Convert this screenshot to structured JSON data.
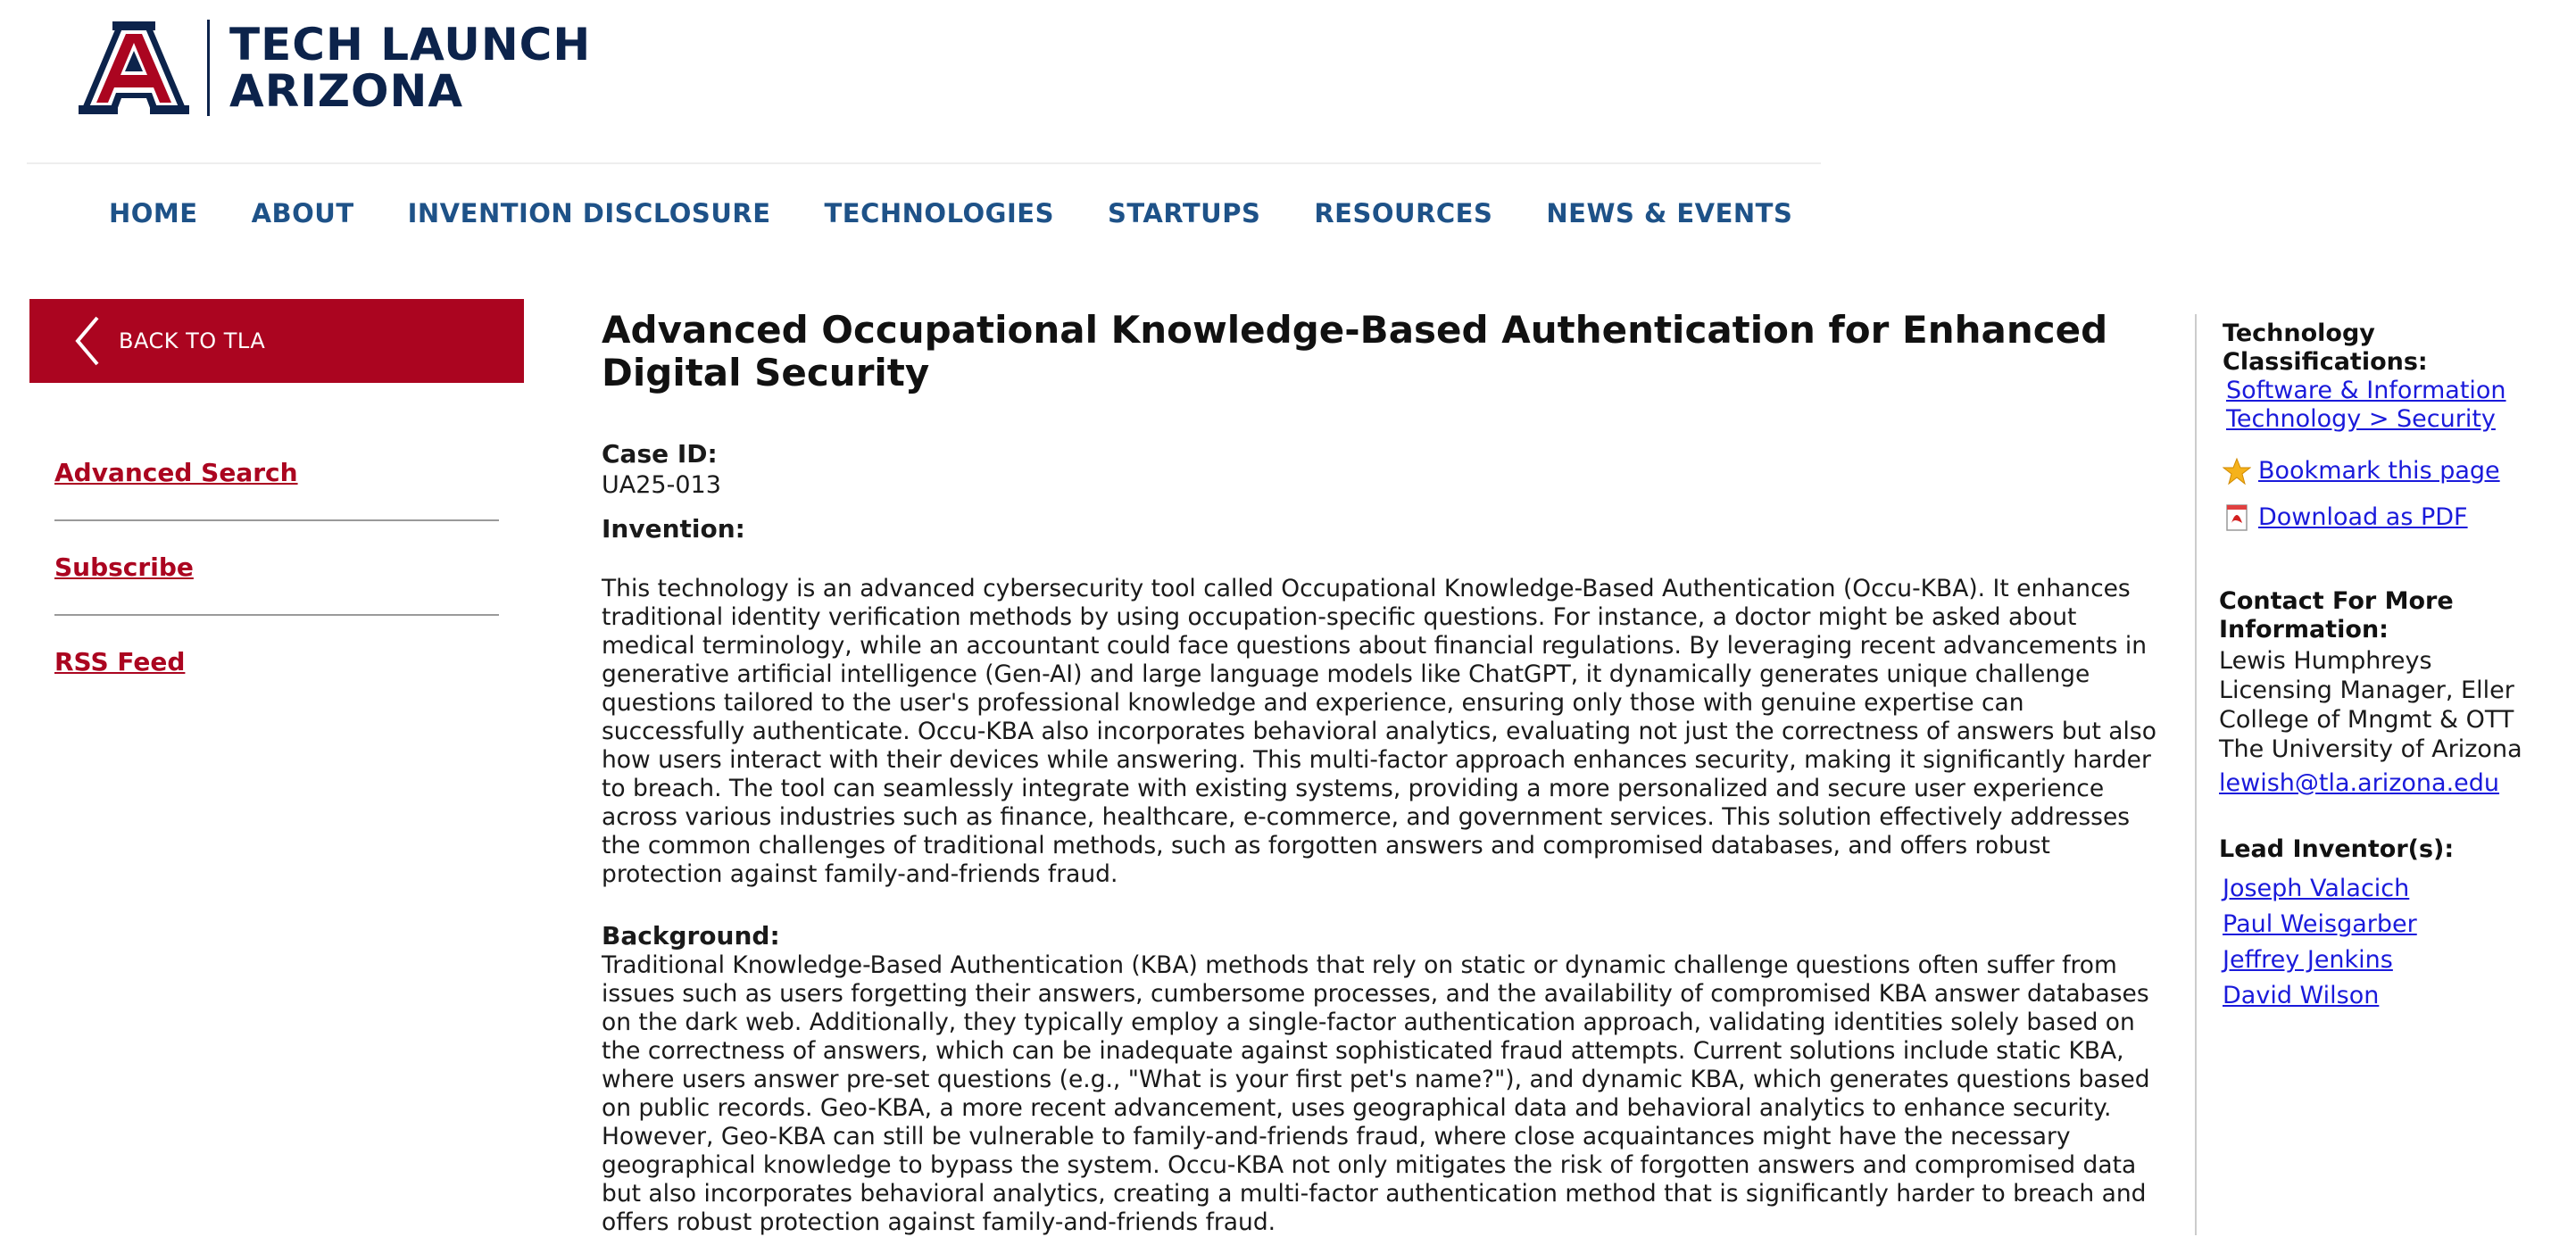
{
  "brand": {
    "name_line1": "TECH LAUNCH",
    "name_line2": "ARIZONA",
    "colors": {
      "navy": "#0c234b",
      "red": "#ab0520",
      "nav_blue": "#1e5288",
      "link_blue": "#1a1adb"
    },
    "logo_icon": "ua-block-a-logo"
  },
  "nav": {
    "items": [
      {
        "label": "HOME"
      },
      {
        "label": "ABOUT"
      },
      {
        "label": "INVENTION DISCLOSURE"
      },
      {
        "label": "TECHNOLOGIES"
      },
      {
        "label": "STARTUPS"
      },
      {
        "label": "RESOURCES"
      },
      {
        "label": "NEWS & EVENTS"
      }
    ]
  },
  "sidebar": {
    "back_label": "BACK TO TLA",
    "back_icon": "chevron-left-icon",
    "links": [
      {
        "label": "Advanced Search"
      },
      {
        "label": "Subscribe"
      },
      {
        "label": "RSS Feed"
      }
    ]
  },
  "main": {
    "title": "Advanced Occupational Knowledge-Based Authentication for Enhanced Digital Security",
    "case_id_label": "Case ID:",
    "case_id": "UA25-013",
    "invention_label": "Invention:",
    "invention_text": "This technology is an advanced cybersecurity tool called Occupational Knowledge-Based Authentication (Occu-KBA). It enhances traditional identity verification methods by using occupation-specific questions. For instance, a doctor might be asked about medical terminology, while an accountant could face questions about financial regulations. By leveraging recent advancements in generative artificial intelligence (Gen-AI) and large language models like ChatGPT, it dynamically generates unique challenge questions tailored to the user's professional knowledge and experience, ensuring only those with genuine expertise can successfully authenticate. Occu-KBA also incorporates behavioral analytics, evaluating not just the correctness of answers but also how users interact with their devices while answering. This multi-factor approach enhances security, making it significantly harder to breach. The tool can seamlessly integrate with existing systems, providing a more personalized and secure user experience across various industries such as finance, healthcare, e-commerce, and government services. This solution effectively addresses the common challenges of traditional methods, such as forgotten answers and compromised databases, and offers robust protection against family-and-friends fraud.",
    "background_label": "Background:",
    "background_text": "Traditional Knowledge-Based Authentication (KBA) methods that rely on static or dynamic challenge questions often suffer from issues such as users forgetting their answers, cumbersome processes, and the availability of compromised KBA answer databases on the dark web. Additionally, they typically employ a single-factor authentication approach, validating identities solely based on the correctness of answers, which can be inadequate against sophisticated fraud attempts. Current solutions include static KBA, where users answer pre-set questions (e.g., \"What is your first pet's name?\"), and dynamic KBA, which generates questions based on public records. Geo-KBA, a more recent advancement, uses geographical data and behavioral analytics to enhance security. However, Geo-KBA can still be vulnerable to family-and-friends fraud, where close acquaintances might have the necessary geographical knowledge to bypass the system. Occu-KBA not only mitigates the risk of forgotten answers and compromised data but also incorporates behavioral analytics, creating a multi-factor authentication method that is significantly harder to breach and offers robust protection against family-and-friends fraud."
  },
  "right": {
    "classifications_heading": "Technology Classifications:",
    "classification_link_line1": "Software & Information",
    "classification_link_line2": "Technology > Security",
    "bookmark_icon": "star-icon",
    "bookmark_label": "Bookmark this page",
    "pdf_icon": "pdf-icon",
    "pdf_label": "Download as PDF",
    "contact_heading_line1": "Contact For More",
    "contact_heading_line2": "Information:",
    "contact_name": "Lewis Humphreys",
    "contact_title_line1": "Licensing Manager, Eller",
    "contact_title_line2": "College of Mngmt & OTT",
    "contact_org": "The University of Arizona",
    "contact_email": "lewish@tla.arizona.edu",
    "inventors_heading": "Lead Inventor(s):",
    "inventors": [
      {
        "name": "Joseph Valacich"
      },
      {
        "name": "Paul Weisgarber"
      },
      {
        "name": "Jeffrey Jenkins"
      },
      {
        "name": "David Wilson"
      }
    ]
  }
}
